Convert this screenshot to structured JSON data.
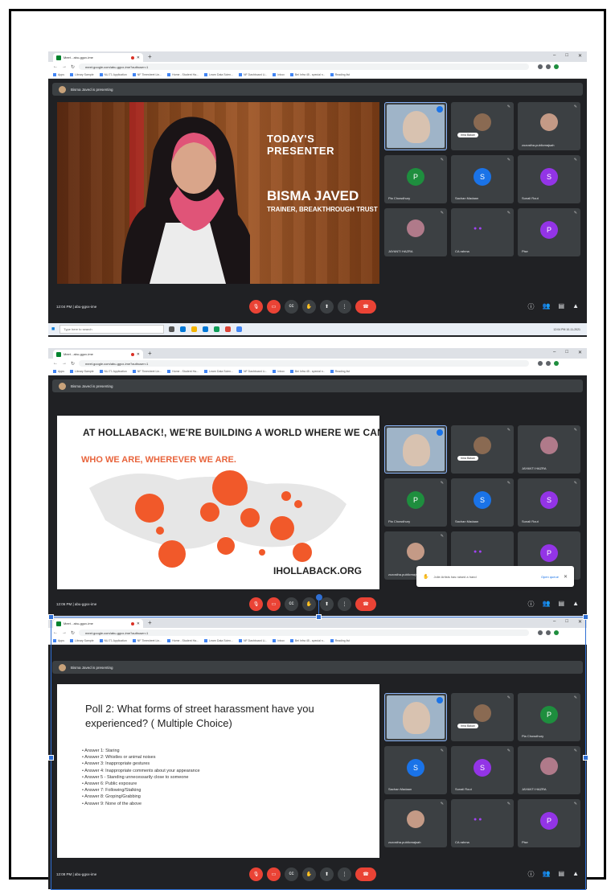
{
  "screenshots": [
    {
      "tab_title": "Meet - abu-gguv-ime",
      "url": "meet.google.com/abu-ggvx-ime?authuser=1",
      "bookmarks": [
        "Apps",
        "Library Sample",
        "NU-T1 Application",
        "NF Timesheet Lin...",
        "Home - Student Ha...",
        "Learn Data Scien...",
        "NF Dashboard Li...",
        "Inbox",
        "Bei Infra 45 - special n..",
        "Reading list"
      ],
      "presenting_label": "Bisma Javed is presenting",
      "meeting_info": "12:04 PM | abu-ggvx-ime",
      "slide": {
        "title": "TODAY'S PRESENTER",
        "name": "BISMA JAVED",
        "role": "TRAINER, BREAKTHROUGH TRUST"
      },
      "participants": [
        {
          "name": "",
          "type": "self"
        },
        {
          "name": "Irma Bakan",
          "type": "video-pill"
        },
        {
          "name": "zozostha.publicmajsah",
          "type": "video"
        },
        {
          "name": "Pia Chowdhury",
          "initial": "P",
          "color": "#1e8e3e"
        },
        {
          "name": "Sachan Madaan",
          "initial": "S",
          "color": "#1a73e8"
        },
        {
          "name": "Sunali Rout",
          "initial": "S",
          "color": "#9334e6"
        },
        {
          "name": "JAYANTI HAZRA",
          "type": "video"
        },
        {
          "name": "CA rahma",
          "type": "dots"
        },
        {
          "name": "Pise",
          "initial": "P",
          "color": "#9334e6"
        }
      ],
      "taskbar": {
        "search_placeholder": "Type here to search",
        "clock": "12:04 PM 10-11-2021"
      }
    },
    {
      "tab_title": "Meet - abu-gguv-ime",
      "url": "meet.google.com/abu-ggvx-ime?authuser=1",
      "bookmarks": [
        "Apps",
        "Library Sample",
        "NU-T1 Application",
        "NF Timesheet Lin...",
        "Home - Student Ha...",
        "Learn Data Scien...",
        "NF Dashboard Li...",
        "Inbox",
        "Bei Infra 45 - special n..",
        "Reading list"
      ],
      "presenting_label": "Bisma Javed is presenting",
      "meeting_info": "12:06 PM | abu-ggvx-ime",
      "slide": {
        "line1": "AT HOLLABACK!, WE'RE BUILDING A WORLD WHERE WE CAN ALL BE",
        "line2": "WHO WE ARE, WHEREVER WE ARE.",
        "site": "IHOLLABACK.ORG"
      },
      "participants": [
        {
          "name": "",
          "type": "self"
        },
        {
          "name": "Irma Bakan",
          "type": "video-pill"
        },
        {
          "name": "JAYANTI HAZRA",
          "type": "video"
        },
        {
          "name": "Pia Chowdhury",
          "initial": "P",
          "color": "#1e8e3e"
        },
        {
          "name": "Sachan Madaan",
          "initial": "S",
          "color": "#1a73e8"
        },
        {
          "name": "Sunali Rout",
          "initial": "S",
          "color": "#9334e6"
        },
        {
          "name": "zozostha.publicmajsah",
          "type": "video"
        },
        {
          "name": "",
          "type": "dots"
        },
        {
          "name": "",
          "initial": "P",
          "color": "#9334e6"
        }
      ],
      "toast": {
        "text": "Jolie Artists has raised a hand",
        "action": "Open queue"
      }
    },
    {
      "tab_title": "Meet - abu-gguv-ime",
      "url": "meet.google.com/abu-ggvx-ime?authuser=1",
      "bookmarks": [
        "Apps",
        "Library Sample",
        "NU-T1 Application",
        "NF Timesheet Lin...",
        "Home - Student Ha...",
        "Learn Data Scien...",
        "NF Dashboard Li...",
        "Inbox",
        "Bei Infra 45 - special n..",
        "Reading list"
      ],
      "presenting_label": "Bisma Javed is presenting",
      "meeting_info": "12:08 PM | abu-ggvx-ime",
      "slide": {
        "question": "Poll 2: What forms of street harassment have you experienced? ( Multiple Choice)",
        "answers": [
          "Answer 1: Staring",
          "Answer 2: Whistles or animal noises",
          "Answer 3: Inappropriate gestures",
          "Answer 4: Inappropriate comments about your appearance",
          "Answer 5 - Standing unnecessarily close to someone",
          "Answer 6: Public exposure",
          "Answer 7: Following/Stalking",
          "Answer 8: Groping/Grabbing",
          "Answer 9: None of the above"
        ]
      },
      "participants": [
        {
          "name": "",
          "type": "self"
        },
        {
          "name": "Irma Bakan",
          "type": "video-pill"
        },
        {
          "name": "Pia Chowdhury",
          "initial": "P",
          "color": "#1e8e3e"
        },
        {
          "name": "Sachan Madaan",
          "initial": "S",
          "color": "#1a73e8"
        },
        {
          "name": "Sunali Rout",
          "initial": "S",
          "color": "#9334e6"
        },
        {
          "name": "JAYANTI HAZRA",
          "type": "video"
        },
        {
          "name": "zozostha.publicmajsah",
          "type": "video"
        },
        {
          "name": "CA rahma",
          "type": "dots"
        },
        {
          "name": "Pise",
          "initial": "P",
          "color": "#9334e6"
        }
      ]
    }
  ],
  "controls": {
    "mic": "mic-off-icon",
    "camera": "camera-off-icon",
    "captions": "captions-icon",
    "raise_hand": "raise-hand-icon",
    "present": "present-icon",
    "more": "more-icon",
    "end_call": "end-call-icon",
    "info": "info-icon",
    "people": "people-icon",
    "chat": "chat-icon",
    "activities": "activities-icon"
  },
  "colors": {
    "meet_bg": "#202124",
    "tile_bg": "#3c4043",
    "end_red": "#ea4335",
    "selection_blue": "#2f6fd4"
  }
}
